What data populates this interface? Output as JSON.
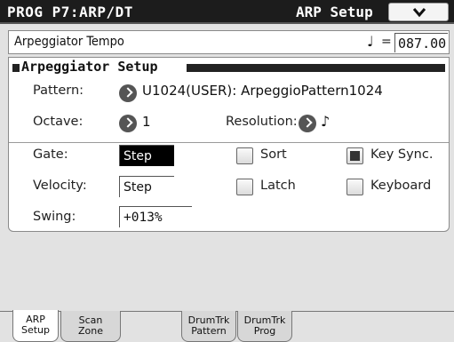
{
  "header": {
    "program": "PROG P7:ARP/DT",
    "page": "ARP Setup"
  },
  "tempo": {
    "label": "Arpeggiator Tempo",
    "note_symbol": "♩",
    "equals": "=",
    "value": "087.00"
  },
  "arp_setup": {
    "title": "Arpeggiator Setup",
    "pattern": {
      "label": "Pattern:",
      "value": "U1024(USER): ArpeggioPattern1024"
    },
    "octave": {
      "label": "Octave:",
      "value": "1"
    },
    "resolution": {
      "label": "Resolution:",
      "value": "♪"
    },
    "gate": {
      "label": "Gate:",
      "value": "Step"
    },
    "velocity": {
      "label": "Velocity:",
      "value": "Step"
    },
    "swing": {
      "label": "Swing:",
      "value": "+013%"
    },
    "checkboxes": {
      "sort": {
        "label": "Sort",
        "checked": false
      },
      "key_sync": {
        "label": "Key Sync.",
        "checked": true
      },
      "latch": {
        "label": "Latch",
        "checked": false
      },
      "keyboard": {
        "label": "Keyboard",
        "checked": false
      }
    }
  },
  "tabs": [
    {
      "line1": "ARP",
      "line2": "Setup",
      "active": true
    },
    {
      "line1": "Scan",
      "line2": "Zone",
      "active": false
    },
    {
      "line1": "DrumTrk",
      "line2": "Pattern",
      "active": false
    },
    {
      "line1": "DrumTrk",
      "line2": "Prog",
      "active": false
    }
  ],
  "icons": {
    "menu": "chevron-down-icon",
    "arrow": "arrow-right-icon"
  },
  "colors": {
    "title_bar": "#1c1c1c",
    "background": "#e2e2e2",
    "panel": "#ffffff",
    "selected_field": "#000000"
  }
}
